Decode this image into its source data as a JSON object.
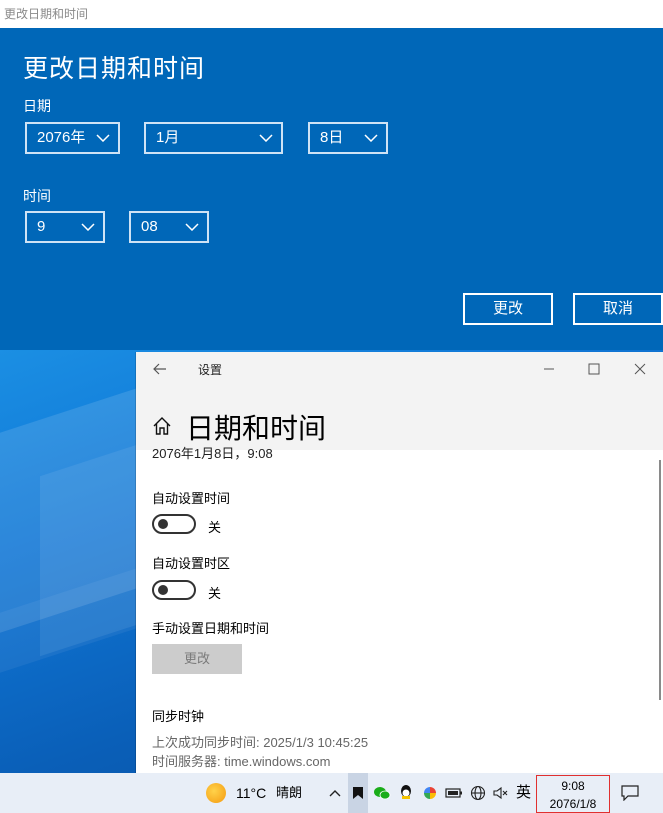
{
  "dialog": {
    "window_title": "更改日期和时间",
    "heading": "更改日期和时间",
    "date_label": "日期",
    "year": "2076年",
    "month": "1月",
    "day": "8日",
    "time_label": "时间",
    "hour": "9",
    "minute": "08",
    "change_button": "更改",
    "cancel_button": "取消"
  },
  "settings": {
    "window_title": "设置",
    "page_title": "日期和时间",
    "current_datetime": "2076年1月8日，9:08",
    "auto_time_label": "自动设置时间",
    "auto_time_state": "关",
    "auto_timezone_label": "自动设置时区",
    "auto_timezone_state": "关",
    "manual_label": "手动设置日期和时间",
    "manual_button": "更改",
    "sync_heading": "同步时钟",
    "last_sync": "上次成功同步时间: 2025/1/3 10:45:25",
    "time_server": "时间服务器: time.windows.com"
  },
  "taskbar": {
    "temperature": "11°C",
    "weather": "晴朗",
    "language": "英",
    "clock_time": "9:08",
    "clock_date": "2076/1/8",
    "icons": [
      "chevron-up-icon",
      "app-icon",
      "wechat-icon",
      "qq-icon",
      "colorful-app-icon",
      "battery-icon",
      "network-icon",
      "volume-muted-icon",
      "notification-icon"
    ]
  },
  "colors": {
    "dialog_bg": "#0067b8",
    "taskbar_bg": "#e8eef7",
    "clock_highlight": "#e03030"
  }
}
